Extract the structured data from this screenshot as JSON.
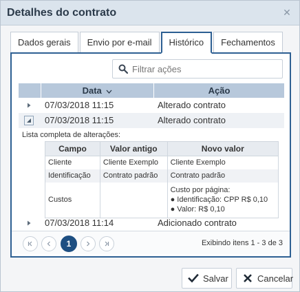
{
  "dialog": {
    "title": "Detalhes do contrato",
    "close_icon": "close-icon"
  },
  "tabs": [
    {
      "label": "Dados gerais",
      "active": false
    },
    {
      "label": "Envio por e-mail",
      "active": false
    },
    {
      "label": "Histórico",
      "active": true
    },
    {
      "label": "Fechamentos",
      "active": false
    }
  ],
  "search": {
    "placeholder": "Filtrar ações",
    "value": ""
  },
  "grid": {
    "columns": {
      "date": "Data",
      "date_sort_icon": "chevron-down-icon",
      "action": "Ação"
    },
    "rows": [
      {
        "date": "07/03/2018 11:15",
        "action": "Alterado contrato",
        "expanded": false
      },
      {
        "date": "07/03/2018 11:15",
        "action": "Alterado contrato",
        "expanded": true
      },
      {
        "date": "07/03/2018 11:14",
        "action": "Adicionado contrato",
        "expanded": false
      }
    ],
    "detail": {
      "caption": "Lista completa de alterações:",
      "headers": {
        "field": "Campo",
        "old": "Valor antigo",
        "new": "Novo valor"
      },
      "changes": [
        {
          "field": "Cliente",
          "old": "Cliente Exemplo",
          "new": "Cliente Exemplo"
        },
        {
          "field": "Identificação",
          "old": "Contrato padrão",
          "new": "Contrato padrão"
        },
        {
          "field": "Custos",
          "old": "",
          "new_title": "Custo por página:",
          "new_lines": [
            "● Identificação: CPP R$ 0,10",
            "● Valor: R$ 0,10"
          ]
        }
      ]
    }
  },
  "pager": {
    "first_icon": "first-page-icon",
    "prev_icon": "previous-page-icon",
    "current_page": "1",
    "next_icon": "next-page-icon",
    "last_icon": "last-page-icon",
    "info": "Exibindo itens 1 - 3 de 3"
  },
  "buttons": {
    "save": {
      "label": "Salvar",
      "icon": "checkmark-icon"
    },
    "cancel": {
      "label": "Cancelar",
      "icon": "x-icon"
    }
  },
  "colors": {
    "accent": "#2d5f92",
    "header": "#b7c8db",
    "titlebar": "#dbe4ed",
    "page_current": "#1e4f82"
  }
}
